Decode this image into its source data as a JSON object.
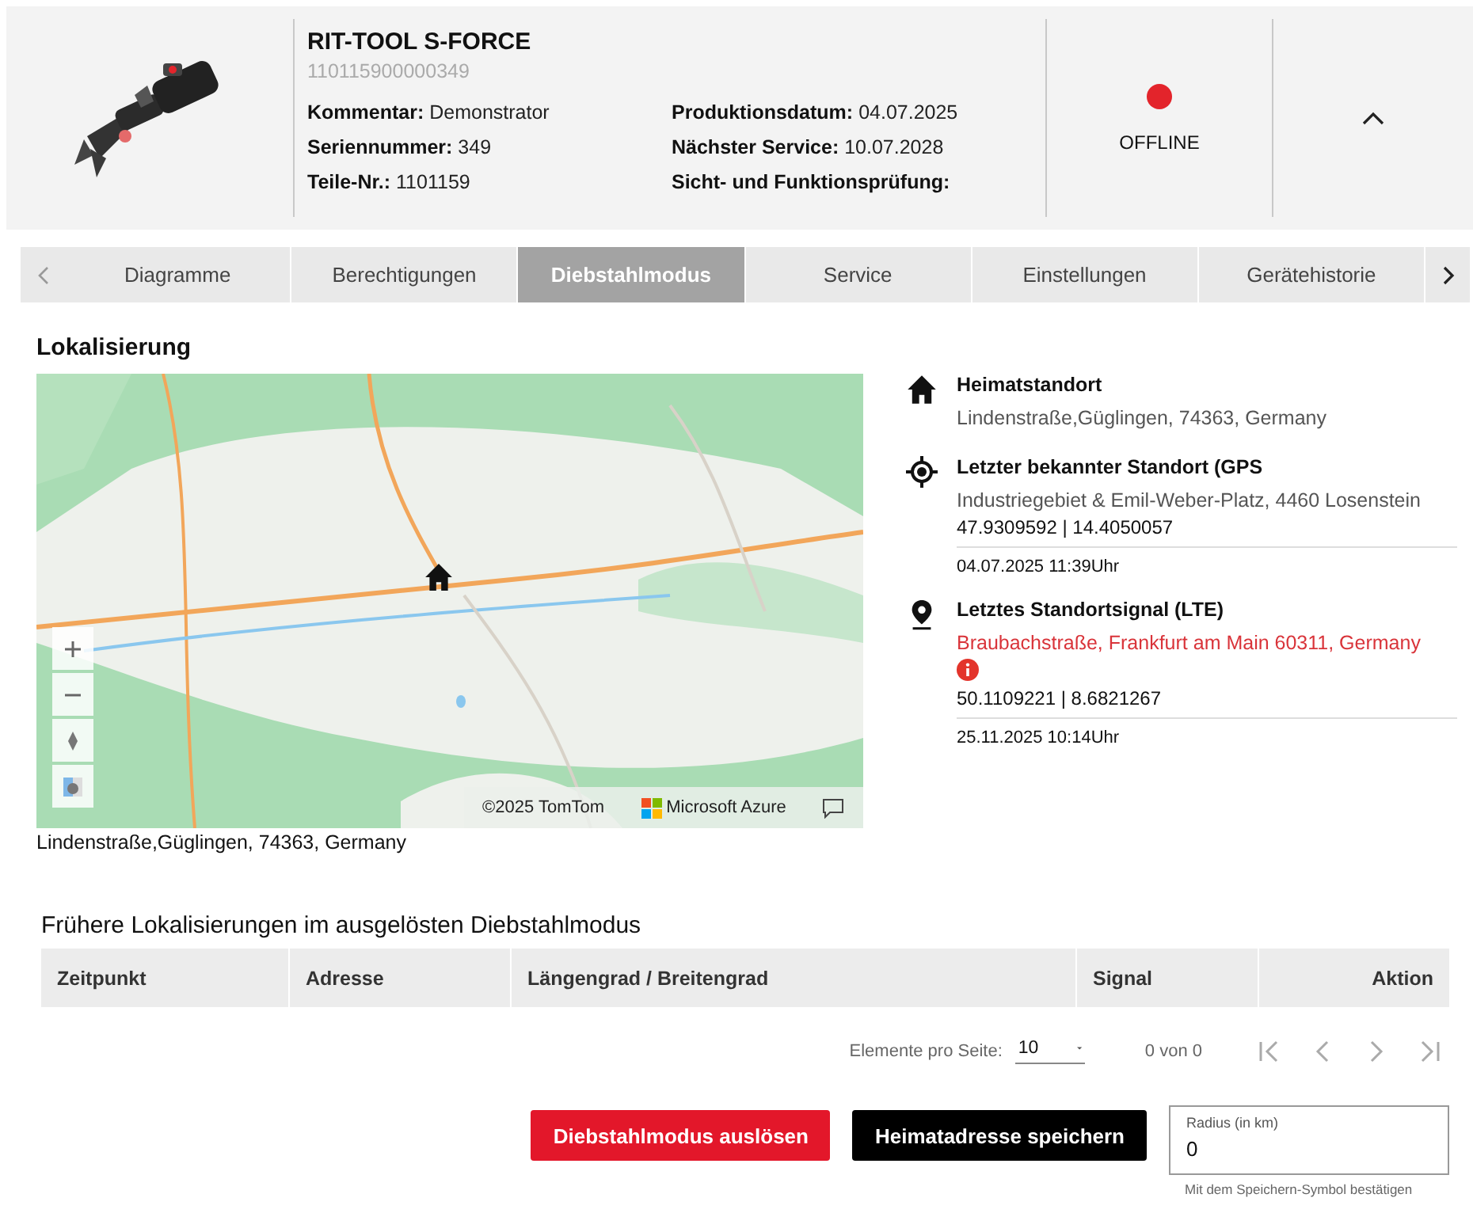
{
  "device": {
    "name": "RIT-TOOL S-FORCE",
    "number": "110115900000349",
    "fields": [
      {
        "label": "Kommentar:",
        "value": "Demonstrator"
      },
      {
        "label": "Seriennummer:",
        "value": "349"
      },
      {
        "label": "Teile-Nr.:",
        "value": "1101159"
      },
      {
        "label": "Produktionsdatum:",
        "value": "04.07.2025"
      },
      {
        "label": "Nächster Service:",
        "value": "10.07.2028"
      },
      {
        "label": "Sicht- und Funktionsprüfung:"
      }
    ],
    "status": "OFFLINE",
    "online": false,
    "expanded": true
  },
  "tabs": [
    {
      "label": "Diagramme",
      "selected": false
    },
    {
      "label": "Berechtigungen",
      "selected": false
    },
    {
      "label": "Diebstahlmodus",
      "selected": true
    },
    {
      "label": "Service",
      "selected": false
    },
    {
      "label": "Einstellungen",
      "selected": false
    },
    {
      "label": "Gerätehistorie",
      "selected": false
    }
  ],
  "localization": {
    "title": "Lokalisierung",
    "map": {
      "kind": "picture",
      "attribution": "©2025 TomTom",
      "provider": "Microsoft Azure"
    },
    "address": "Lindenstraße,Güglingen, 74363, Germany",
    "locations": [
      {
        "kind": "home",
        "title": "Heimatstandort",
        "address": "Lindenstraße,Güglingen, 74363, Germany",
        "warning": false
      },
      {
        "kind": "gps",
        "title": "Letzter bekannter Standort (GPS",
        "address": "Industriegebiet & Emil-Weber-Platz, 4460 Losenstein",
        "coords": "47.9309592 | 14.4050057",
        "time": "04.07.2025 11:39Uhr",
        "warning": false
      },
      {
        "kind": "lte",
        "title": "Letztes Standortsignal (LTE)",
        "address": "Braubachstraße, Frankfurt am Main 60311, Germany",
        "coords": "50.1109221 | 8.6821267",
        "time": "25.11.2025 10:14Uhr",
        "warning": true
      }
    ]
  },
  "history": {
    "title": "Frühere Lokalisierungen im ausgelösten Diebstahlmodus",
    "columns": [
      "Zeitpunkt",
      "Adresse",
      "Längengrad / Breitengrad",
      "Signal",
      "Aktion"
    ],
    "per_page_label": "Elemente pro Seite:",
    "per_page": "10",
    "range": "0 von 0"
  },
  "actions": {
    "buttons": [
      {
        "label": "Diebstahlmodus auslösen",
        "kind": "danger"
      },
      {
        "label": "Heimatadresse speichern",
        "kind": "dark"
      }
    ],
    "radius": {
      "label": "Radius (in km)",
      "value": "0",
      "hint": "Mit dem Speichern-Symbol bestätigen"
    }
  }
}
